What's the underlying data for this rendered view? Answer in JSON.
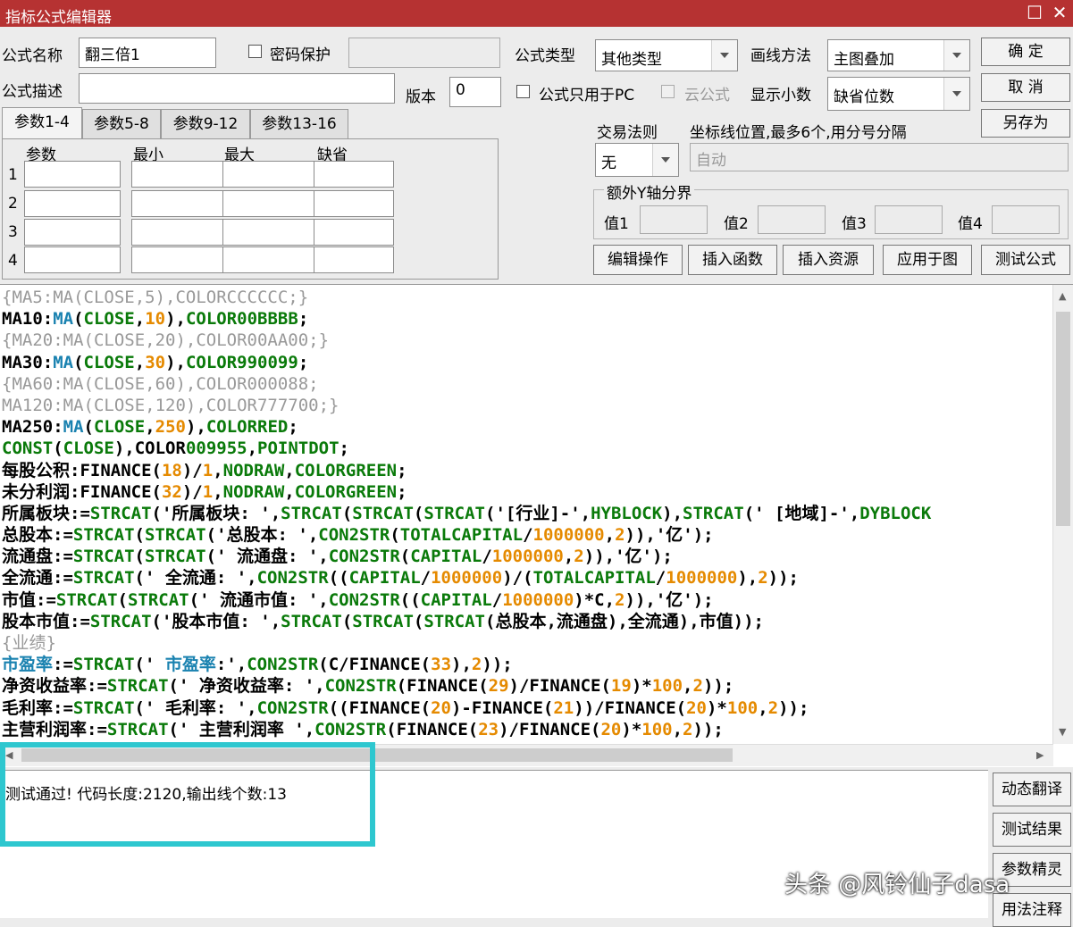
{
  "window": {
    "title": "指标公式编辑器"
  },
  "form": {
    "name_label": "公式名称",
    "name_value": "翻三倍1",
    "password_label": "密码保护",
    "desc_label": "公式描述",
    "desc_value": "",
    "version_label": "版本",
    "version_value": "0",
    "type_label": "公式类型",
    "type_value": "其他类型",
    "draw_label": "画线方法",
    "draw_value": "主图叠加",
    "pc_only_label": "公式只用于PC",
    "cloud_label": "云公式",
    "decimals_label": "显示小数",
    "decimals_value": "缺省位数",
    "trade_rule_label": "交易法则",
    "trade_rule_value": "无",
    "coord_label": "坐标线位置,最多6个,用分号分隔",
    "coord_value": "自动",
    "extra_y_label": "额外Y轴分界",
    "val1": "值1",
    "val2": "值2",
    "val3": "值3",
    "val4": "值4"
  },
  "buttons": {
    "ok": "确  定",
    "cancel": "取  消",
    "save_as": "另存为",
    "edit_ops": "编辑操作",
    "insert_func": "插入函数",
    "insert_res": "插入资源",
    "apply_chart": "应用于图",
    "test_formula": "测试公式"
  },
  "tabs": [
    "参数1-4",
    "参数5-8",
    "参数9-12",
    "参数13-16"
  ],
  "params": {
    "headers": [
      "参数",
      "最小",
      "最大",
      "缺省"
    ],
    "rows": [
      "1",
      "2",
      "3",
      "4"
    ]
  },
  "code_lines": [
    [
      [
        "c",
        "{MA5:MA(CLOSE,5),COLORCCCCCC;}"
      ]
    ],
    [
      [
        "d",
        "MA10:"
      ],
      [
        "f",
        "MA"
      ],
      [
        "d",
        "("
      ],
      [
        "k",
        "CLOSE"
      ],
      [
        "d",
        ","
      ],
      [
        "n",
        "10"
      ],
      [
        "d",
        "),"
      ],
      [
        "k",
        "COLOR00BBBB"
      ],
      [
        "d",
        ";"
      ]
    ],
    [
      [
        "c",
        "{MA20:MA(CLOSE,20),COLOR00AA00;}"
      ]
    ],
    [
      [
        "d",
        "MA30:"
      ],
      [
        "f",
        "MA"
      ],
      [
        "d",
        "("
      ],
      [
        "k",
        "CLOSE"
      ],
      [
        "d",
        ","
      ],
      [
        "n",
        "30"
      ],
      [
        "d",
        "),"
      ],
      [
        "k",
        "COLOR990099"
      ],
      [
        "d",
        ";"
      ]
    ],
    [
      [
        "c",
        "{MA60:MA(CLOSE,60),COLOR000088;"
      ]
    ],
    [
      [
        "c",
        "MA120:MA(CLOSE,120),COLOR777700;}"
      ]
    ],
    [
      [
        "d",
        "MA250:"
      ],
      [
        "f",
        "MA"
      ],
      [
        "d",
        "("
      ],
      [
        "k",
        "CLOSE"
      ],
      [
        "d",
        ","
      ],
      [
        "n",
        "250"
      ],
      [
        "d",
        "),"
      ],
      [
        "k",
        "COLORRED"
      ],
      [
        "d",
        ";"
      ]
    ],
    [
      [
        "k",
        "CONST"
      ],
      [
        "d",
        "("
      ],
      [
        "k",
        "CLOSE"
      ],
      [
        "d",
        "),COLOR"
      ],
      [
        "k",
        "009955"
      ],
      [
        "d",
        ","
      ],
      [
        "k",
        "POINTDOT"
      ],
      [
        "d",
        ";"
      ]
    ],
    [
      [
        "d",
        "每股公积:FINANCE("
      ],
      [
        "n",
        "18"
      ],
      [
        "d",
        ")/"
      ],
      [
        "n",
        "1"
      ],
      [
        "d",
        ","
      ],
      [
        "k",
        "NODRAW"
      ],
      [
        "d",
        ","
      ],
      [
        "k",
        "COLORGREEN"
      ],
      [
        "d",
        ";"
      ]
    ],
    [
      [
        "d",
        "未分利润:FINANCE("
      ],
      [
        "n",
        "32"
      ],
      [
        "d",
        ")/"
      ],
      [
        "n",
        "1"
      ],
      [
        "d",
        ","
      ],
      [
        "k",
        "NODRAW"
      ],
      [
        "d",
        ","
      ],
      [
        "k",
        "COLORGREEN"
      ],
      [
        "d",
        ";"
      ]
    ],
    [
      [
        "d",
        "所属板块:="
      ],
      [
        "k",
        "STRCAT"
      ],
      [
        "d",
        "('所属板块: ',"
      ],
      [
        "k",
        "STRCAT"
      ],
      [
        "d",
        "("
      ],
      [
        "k",
        "STRCAT"
      ],
      [
        "d",
        "("
      ],
      [
        "k",
        "STRCAT"
      ],
      [
        "d",
        "('[行业]-',"
      ],
      [
        "k",
        "HYBLOCK"
      ],
      [
        "d",
        "),"
      ],
      [
        "k",
        "STRCAT"
      ],
      [
        "d",
        "(' [地域]-',"
      ],
      [
        "k",
        "DYBLOCK"
      ]
    ],
    [
      [
        "d",
        "总股本:="
      ],
      [
        "k",
        "STRCAT"
      ],
      [
        "d",
        "("
      ],
      [
        "k",
        "STRCAT"
      ],
      [
        "d",
        "('总股本: ',"
      ],
      [
        "k",
        "CON2STR"
      ],
      [
        "d",
        "("
      ],
      [
        "k",
        "TOTALCAPITAL"
      ],
      [
        "d",
        "/"
      ],
      [
        "n",
        "1000000"
      ],
      [
        "d",
        ","
      ],
      [
        "n",
        "2"
      ],
      [
        "d",
        ")),'亿');"
      ]
    ],
    [
      [
        "d",
        "流通盘:="
      ],
      [
        "k",
        "STRCAT"
      ],
      [
        "d",
        "("
      ],
      [
        "k",
        "STRCAT"
      ],
      [
        "d",
        "(' 流通盘: ',"
      ],
      [
        "k",
        "CON2STR"
      ],
      [
        "d",
        "("
      ],
      [
        "k",
        "CAPITAL"
      ],
      [
        "d",
        "/"
      ],
      [
        "n",
        "1000000"
      ],
      [
        "d",
        ","
      ],
      [
        "n",
        "2"
      ],
      [
        "d",
        ")),'亿');"
      ]
    ],
    [
      [
        "d",
        "全流通:="
      ],
      [
        "k",
        "STRCAT"
      ],
      [
        "d",
        "(' 全流通: ',"
      ],
      [
        "k",
        "CON2STR"
      ],
      [
        "d",
        "(("
      ],
      [
        "k",
        "CAPITAL"
      ],
      [
        "d",
        "/"
      ],
      [
        "n",
        "1000000"
      ],
      [
        "d",
        ")/("
      ],
      [
        "k",
        "TOTALCAPITAL"
      ],
      [
        "d",
        "/"
      ],
      [
        "n",
        "1000000"
      ],
      [
        "d",
        "),"
      ],
      [
        "n",
        "2"
      ],
      [
        "d",
        "));"
      ]
    ],
    [
      [
        "d",
        "市值:="
      ],
      [
        "k",
        "STRCAT"
      ],
      [
        "d",
        "("
      ],
      [
        "k",
        "STRCAT"
      ],
      [
        "d",
        "(' 流通市值: ',"
      ],
      [
        "k",
        "CON2STR"
      ],
      [
        "d",
        "(("
      ],
      [
        "k",
        "CAPITAL"
      ],
      [
        "d",
        "/"
      ],
      [
        "n",
        "1000000"
      ],
      [
        "d",
        ")*C,"
      ],
      [
        "n",
        "2"
      ],
      [
        "d",
        ")),'亿');"
      ]
    ],
    [
      [
        "d",
        "股本市值:="
      ],
      [
        "k",
        "STRCAT"
      ],
      [
        "d",
        "('股本市值: ',"
      ],
      [
        "k",
        "STRCAT"
      ],
      [
        "d",
        "("
      ],
      [
        "k",
        "STRCAT"
      ],
      [
        "d",
        "("
      ],
      [
        "k",
        "STRCAT"
      ],
      [
        "d",
        "(总股本,流通盘),全流通),市值));"
      ]
    ],
    [
      [
        "c",
        "{业绩}"
      ]
    ],
    [
      [
        "f",
        "市盈率"
      ],
      [
        "d",
        ":="
      ],
      [
        "k",
        "STRCAT"
      ],
      [
        "d",
        "(' "
      ],
      [
        "f",
        "市盈率"
      ],
      [
        "d",
        ":',"
      ],
      [
        "k",
        "CON2STR"
      ],
      [
        "d",
        "(C/FINANCE("
      ],
      [
        "n",
        "33"
      ],
      [
        "d",
        "),"
      ],
      [
        "n",
        "2"
      ],
      [
        "d",
        "));"
      ]
    ],
    [
      [
        "d",
        "净资收益率:="
      ],
      [
        "k",
        "STRCAT"
      ],
      [
        "d",
        "(' 净资收益率: ',"
      ],
      [
        "k",
        "CON2STR"
      ],
      [
        "d",
        "(FINANCE("
      ],
      [
        "n",
        "29"
      ],
      [
        "d",
        ")/FINANCE("
      ],
      [
        "n",
        "19"
      ],
      [
        "d",
        ")*"
      ],
      [
        "n",
        "100"
      ],
      [
        "d",
        ","
      ],
      [
        "n",
        "2"
      ],
      [
        "d",
        "));"
      ]
    ],
    [
      [
        "d",
        "毛利率:="
      ],
      [
        "k",
        "STRCAT"
      ],
      [
        "d",
        "(' 毛利率: ',"
      ],
      [
        "k",
        "CON2STR"
      ],
      [
        "d",
        "((FINANCE("
      ],
      [
        "n",
        "20"
      ],
      [
        "d",
        ")-FINANCE("
      ],
      [
        "n",
        "21"
      ],
      [
        "d",
        "))/FINANCE("
      ],
      [
        "n",
        "20"
      ],
      [
        "d",
        ")*"
      ],
      [
        "n",
        "100"
      ],
      [
        "d",
        ","
      ],
      [
        "n",
        "2"
      ],
      [
        "d",
        "));"
      ]
    ],
    [
      [
        "d",
        "主营利润率:="
      ],
      [
        "k",
        "STRCAT"
      ],
      [
        "d",
        "(' 主营利润率 ',"
      ],
      [
        "k",
        "CON2STR"
      ],
      [
        "d",
        "(FINANCE("
      ],
      [
        "n",
        "23"
      ],
      [
        "d",
        ")/FINANCE("
      ],
      [
        "n",
        "20"
      ],
      [
        "d",
        ")*"
      ],
      [
        "n",
        "100"
      ],
      [
        "d",
        ","
      ],
      [
        "n",
        "2"
      ],
      [
        "d",
        "));"
      ]
    ]
  ],
  "result": {
    "text": "测试通过! 代码长度:2120,输出线个数:13"
  },
  "side_buttons": [
    "动态翻译",
    "测试结果",
    "参数精灵",
    "用法注释"
  ],
  "watermark": "头条 @风铃仙子dasa",
  "colors": {
    "titlebar": "#b63232",
    "keyword": "#0a7a0a",
    "function": "#1a82b0",
    "number": "#e58a00",
    "comment": "#999999",
    "highlight": "#2ec7cf"
  }
}
